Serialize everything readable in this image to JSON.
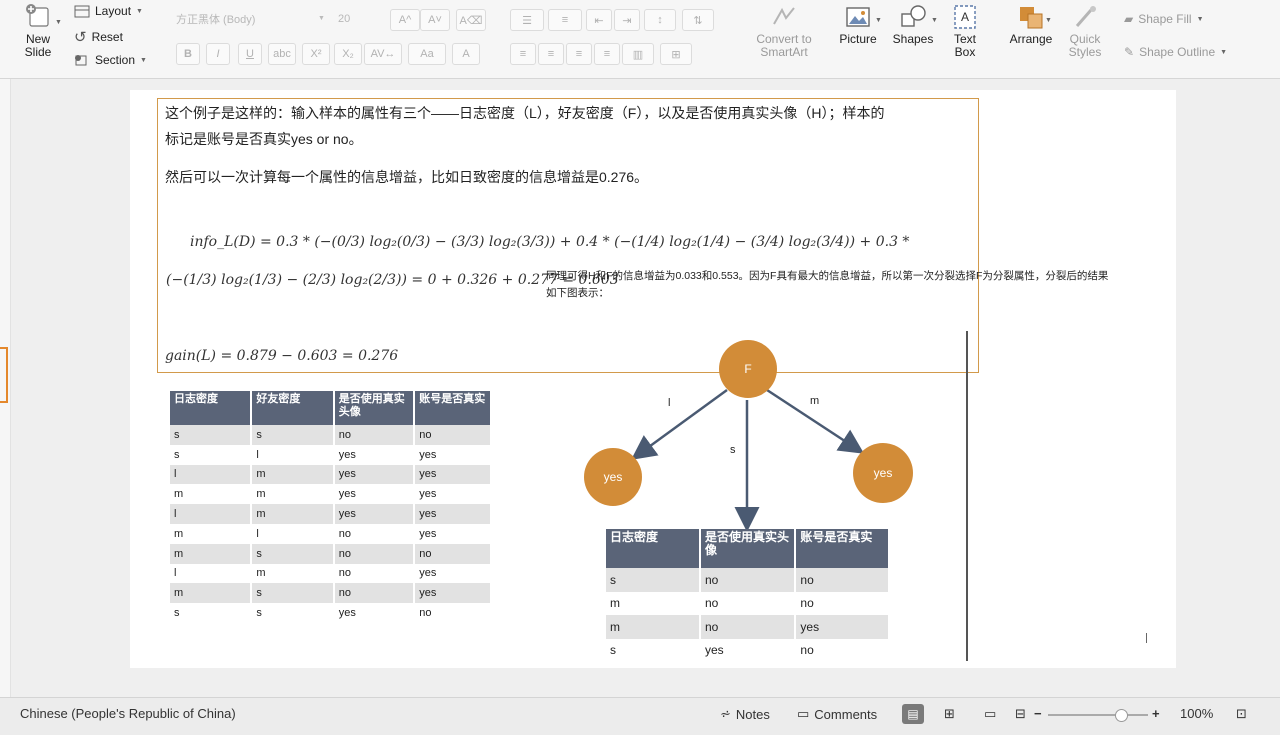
{
  "ribbon": {
    "new_slide": "New\nSlide",
    "layout": "Layout",
    "reset": "Reset",
    "section": "Section",
    "font_name": "方正黑体 (Body)",
    "font_size": "20",
    "convert_smartart": "Convert to\nSmartArt",
    "picture": "Picture",
    "shapes": "Shapes",
    "text_box": "Text\nBox",
    "arrange": "Arrange",
    "quick_styles": "Quick\nStyles",
    "shape_fill": "Shape Fill",
    "shape_outline": "Shape Outline"
  },
  "slide": {
    "para1_line1": "这个例子是这样的：输入样本的属性有三个——日志密度（L），好友密度（F），以及是否使用真实头像（H）；样本的",
    "para1_line2": "标记是账号是否真实yes or no。",
    "para2": "然后可以一次计算每一个属性的信息增益，比如日致密度的信息增益是0.276。",
    "formula_line1": "info_L(D) = 0.3 * (−(0/3) log₂(0/3) − (3/3) log₂(3/3)) + 0.4 * (−(1/4) log₂(1/4) − (3/4) log₂(3/4)) + 0.3 *",
    "formula_line2": "(−(1/3) log₂(1/3) − (2/3) log₂(2/3)) = 0 + 0.326 + 0.277 = 0.603",
    "gain": "gain(L) = 0.879 − 0.603 = 0.276",
    "note_line1": "同理可得H和F的信息增益为0.033和0.553。因为F具有最大的信息增益，所以第一次分裂选择F为分裂属性，分裂后的结果",
    "note_line2": "如下图表示：",
    "table1": {
      "headers": [
        "日志密度",
        "好友密度",
        "是否使用真实头像",
        "账号是否真实"
      ],
      "rows": [
        [
          "s",
          "s",
          "no",
          "no"
        ],
        [
          "s",
          "l",
          "yes",
          "yes"
        ],
        [
          "l",
          "m",
          "yes",
          "yes"
        ],
        [
          "m",
          "m",
          "yes",
          "yes"
        ],
        [
          "l",
          "m",
          "yes",
          "yes"
        ],
        [
          "m",
          "l",
          "no",
          "yes"
        ],
        [
          "m",
          "s",
          "no",
          "no"
        ],
        [
          "l",
          "m",
          "no",
          "yes"
        ],
        [
          "m",
          "s",
          "no",
          "yes"
        ],
        [
          "s",
          "s",
          "yes",
          "no"
        ]
      ]
    },
    "tree": {
      "root": "F",
      "left_leaf": "yes",
      "right_leaf": "yes",
      "edge_l": "l",
      "edge_s": "s",
      "edge_m": "m"
    },
    "table2": {
      "headers": [
        "日志密度",
        "是否使用真实头像",
        "账号是否真实"
      ],
      "rows": [
        [
          "s",
          "no",
          "no"
        ],
        [
          "m",
          "no",
          "no"
        ],
        [
          "m",
          "no",
          "yes"
        ],
        [
          "s",
          "yes",
          "no"
        ]
      ]
    }
  },
  "statusbar": {
    "language": "Chinese (People's Republic of China)",
    "notes": "Notes",
    "comments": "Comments",
    "zoom": "100%",
    "zoom_level": 0.73
  },
  "colors": {
    "accent": "#d28c38",
    "table_header": "#5a6478",
    "frame_border": "#d29a4b",
    "arrow": "#4a5a72"
  }
}
